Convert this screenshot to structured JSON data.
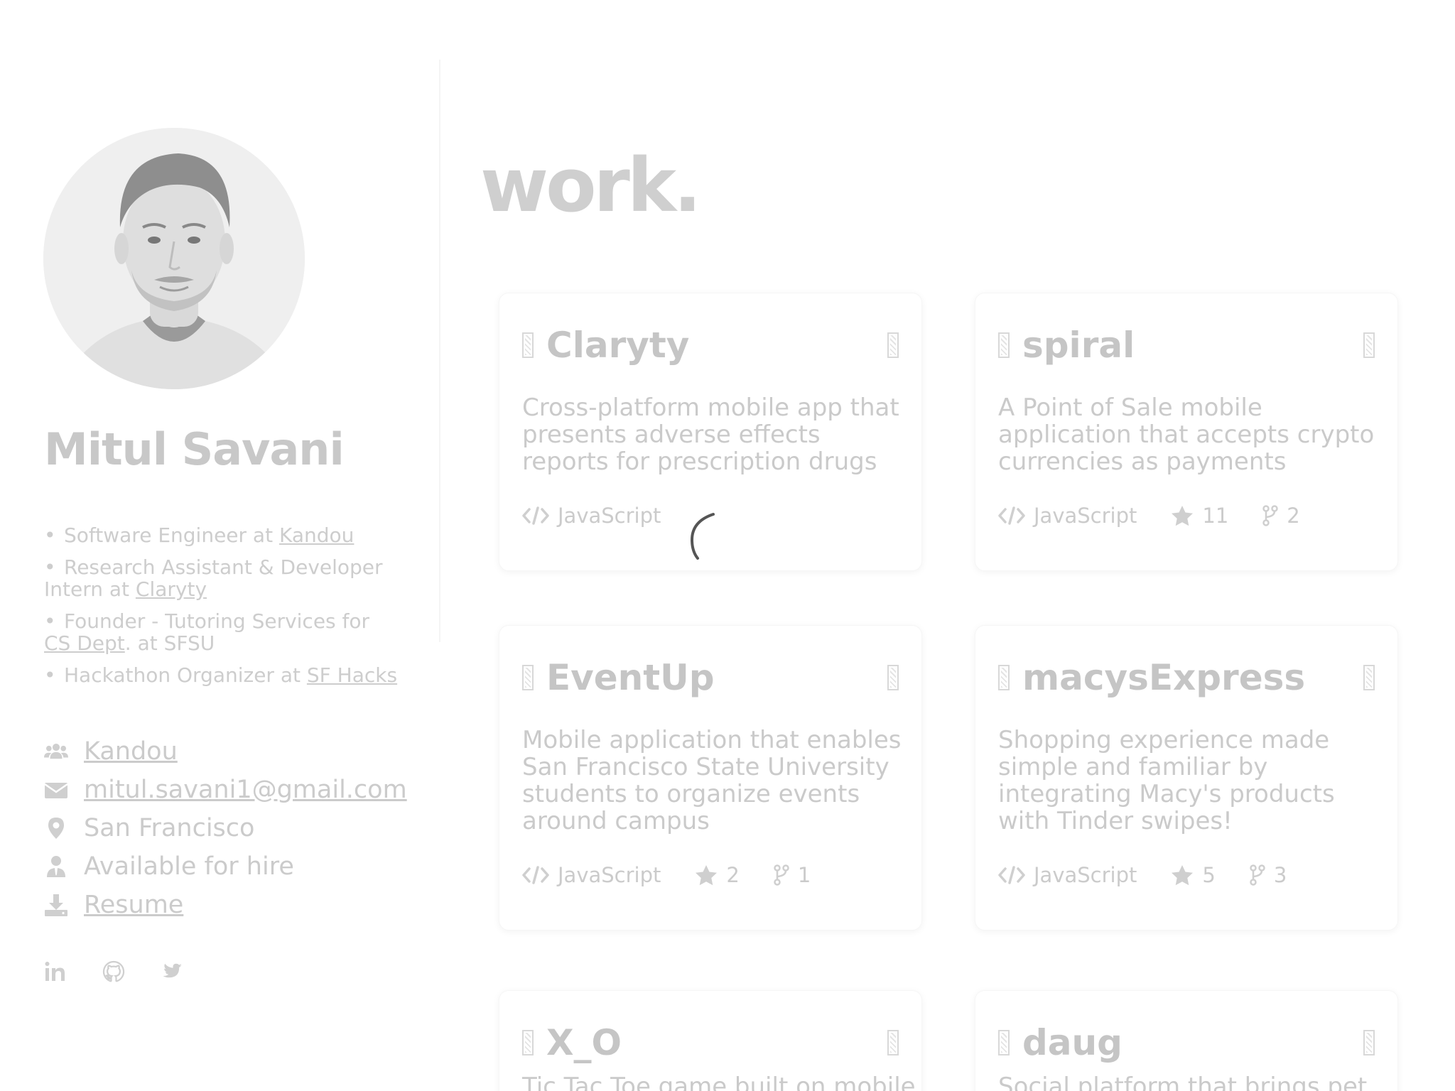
{
  "profile": {
    "name": "Mitul Savani",
    "roles": [
      {
        "text": "Software Engineer at ",
        "link": "Kandou",
        "after": ""
      },
      {
        "text": "Research Assistant & Developer Intern at ",
        "link": "Claryty",
        "after": ""
      },
      {
        "text": "Founder - Tutoring Services for ",
        "link": "CS Dept",
        "after": ". at SFSU"
      },
      {
        "text": "Hackathon Organizer at ",
        "link": "SF Hacks",
        "after": ""
      }
    ],
    "contact": {
      "company": "Kandou",
      "email": "mitul.savani1@gmail.com",
      "location": "San Francisco",
      "hire": "Available for hire",
      "resume": "Resume"
    },
    "social": [
      "linkedin-icon",
      "github-icon",
      "twitter-icon"
    ]
  },
  "main": {
    "title": "work."
  },
  "projects": [
    {
      "name": "Claryty",
      "description": "Cross-platform mobile app that presents adverse effects reports for prescription drugs",
      "language": "JavaScript",
      "stars": "",
      "forks": ""
    },
    {
      "name": "spiral",
      "description": "A Point of Sale mobile application that accepts crypto currencies as payments",
      "language": "JavaScript",
      "stars": "11",
      "forks": "2"
    },
    {
      "name": "EventUp",
      "description": "Mobile application that enables San Francisco State University students to organize events around campus",
      "language": "JavaScript",
      "stars": "2",
      "forks": "1"
    },
    {
      "name": "macysExpress",
      "description": "Shopping experience made simple and familiar by integrating Macy's products with Tinder swipes!",
      "language": "JavaScript",
      "stars": "5",
      "forks": "3"
    },
    {
      "name": "X_O",
      "description": "Tic Tac Toe game built on mobile",
      "language": "",
      "stars": "",
      "forks": ""
    },
    {
      "name": "daug",
      "description": "Social platform that brings pet",
      "language": "",
      "stars": "",
      "forks": ""
    }
  ],
  "colors": {
    "text_faded": "#c8c8c8",
    "spinner": "#555555"
  }
}
